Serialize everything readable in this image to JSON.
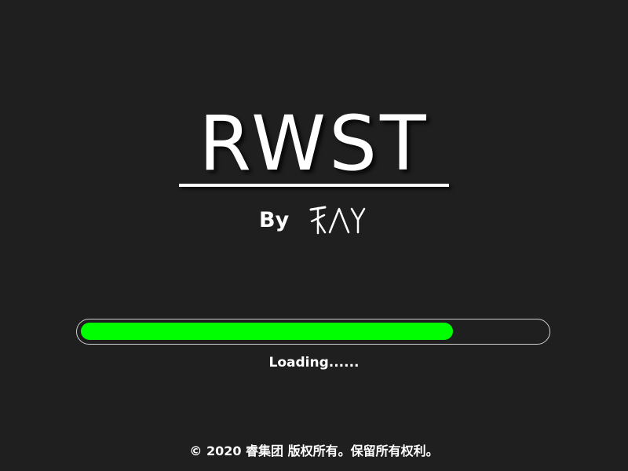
{
  "splash": {
    "title": "RWST",
    "by_label": "By",
    "logo_text": "RAY"
  },
  "progress": {
    "fraction": 0.8,
    "loading_text": "Loading......"
  },
  "footer": {
    "copyright": "© 2020 睿集团 版权所有。保留所有权利。"
  },
  "colors": {
    "background": "#1f1f1f",
    "text": "#ffffff",
    "progress_fill": "#00ff00",
    "progress_border": "#d0d0d0"
  },
  "icons": {
    "logo": "ray-signature-logo"
  }
}
